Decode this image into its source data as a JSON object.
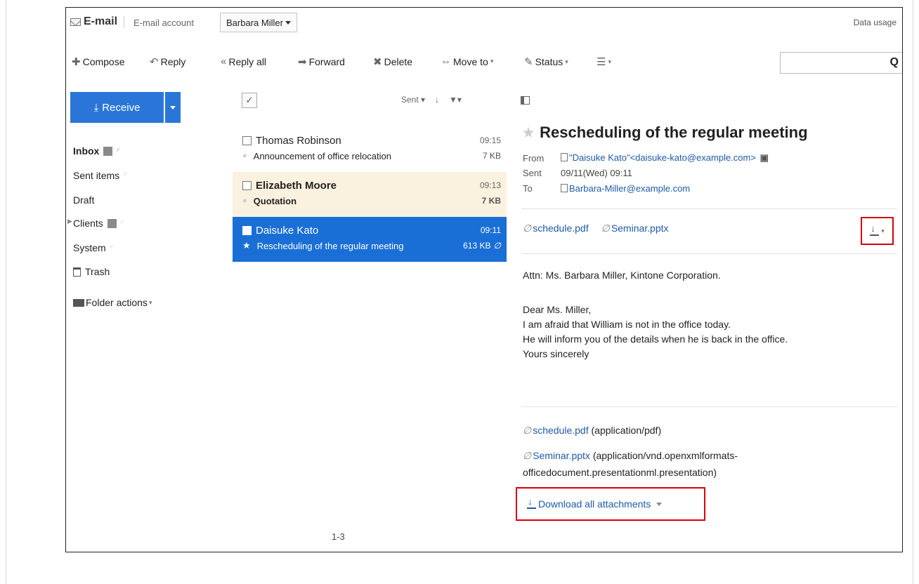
{
  "header": {
    "app_title": "E-mail",
    "account_label": "E-mail account",
    "account_selected": "Barbara Miller",
    "data_usage": "Data usage"
  },
  "toolbar": {
    "compose": "Compose",
    "reply": "Reply",
    "reply_all": "Reply all",
    "forward": "Forward",
    "delete": "Delete",
    "move_to": "Move to",
    "status": "Status",
    "search_placeholder": ""
  },
  "sidebar": {
    "receive_label": "Receive",
    "folders": [
      {
        "label": "Inbox",
        "badge": ""
      },
      {
        "label": "Sent items"
      },
      {
        "label": "Draft"
      },
      {
        "label": "Clients"
      },
      {
        "label": "System"
      },
      {
        "label": "Trash"
      }
    ],
    "folder_actions": "Folder actions"
  },
  "message_list": {
    "sort_label": "Sent",
    "messages": [
      {
        "sender": "Thomas Robinson",
        "time": "09:15",
        "subject": "Announcement of office relocation",
        "size": "7 KB"
      },
      {
        "sender": "Elizabeth Moore",
        "time": "09:13",
        "subject": "Quotation",
        "size": "7 KB"
      },
      {
        "sender": "Daisuke Kato",
        "time": "09:11",
        "subject": "Rescheduling of the regular meeting",
        "size": "613 KB"
      }
    ],
    "page_count": "1-3"
  },
  "message_view": {
    "subject": "Rescheduling of the regular meeting",
    "from_label": "From",
    "from_value": "\"Daisuke Kato\"<daisuke-kato@example.com>",
    "sent_label": "Sent",
    "sent_value": "09/11(Wed) 09:11",
    "to_label": "To",
    "to_value": "Barbara-Miller@example.com",
    "attachments": [
      "schedule.pdf",
      "Seminar.pptx"
    ],
    "body_lines": [
      "Attn: Ms. Barbara Miller, Kintone Corporation.",
      "Dear Ms. Miller,",
      "I am afraid that William is not in the office today.",
      "He will inform you of the details when he is back in the office.",
      "Yours sincerely"
    ],
    "attachment_list": [
      {
        "name": "schedule.pdf",
        "type": "(application/pdf)"
      },
      {
        "name": "Seminar.pptx",
        "type": "(application/vnd.openxmlformats-",
        "type_cont": "officedocument.presentationml.presentation)"
      }
    ],
    "download_all": "Download all attachments"
  },
  "colors": {
    "accent": "#2a76d8",
    "selected_row": "#1a6fd6",
    "unread_row": "#fbf1df",
    "highlight_box": "#d8000c",
    "link": "#1e5aa8"
  }
}
